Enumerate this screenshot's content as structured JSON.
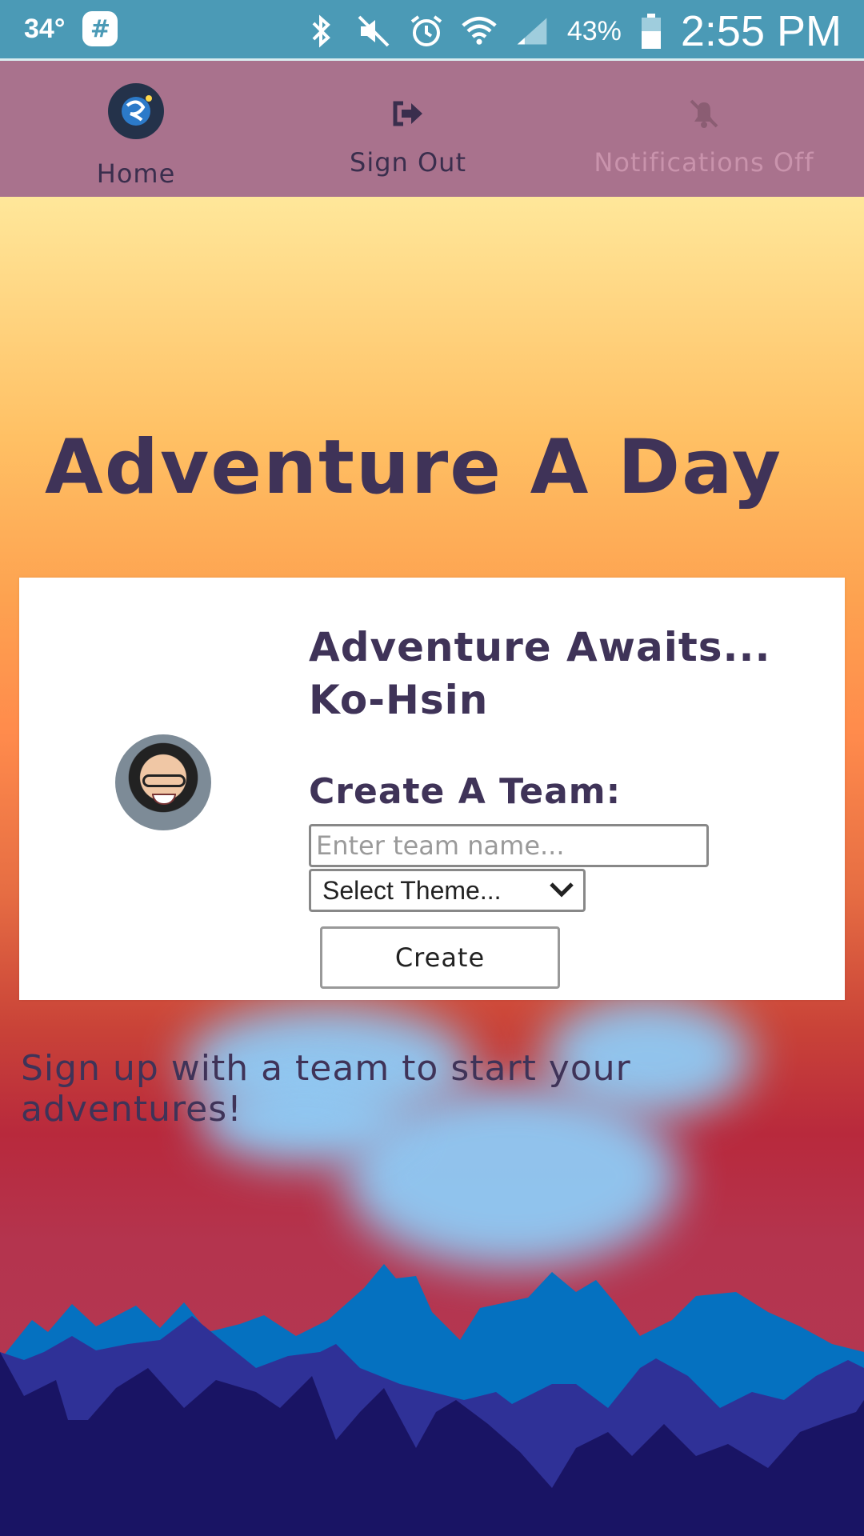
{
  "status_bar": {
    "temperature": "34°",
    "battery": "43%",
    "time": "2:55 PM",
    "icons": [
      "slack-icon",
      "bluetooth-icon",
      "mute-icon",
      "alarm-icon",
      "wifi-icon",
      "signal-icon",
      "battery-icon"
    ]
  },
  "nav": {
    "home_label": "Home",
    "signout_label": "Sign Out",
    "notifications_label": "Notifications Off"
  },
  "hero": {
    "title": "Adventure A Day"
  },
  "card": {
    "heading": "Adventure Awaits... Ko-Hsin",
    "create_label": "Create A Team:",
    "team_placeholder": "Enter team name...",
    "theme_selected": "Select Theme...",
    "create_button": "Create"
  },
  "signup_message": "Sign up with a team to start your adventures!",
  "colors": {
    "status_bar": "#4b9ab6",
    "nav_bar": "#a9728d",
    "title_text": "#3f3358"
  }
}
